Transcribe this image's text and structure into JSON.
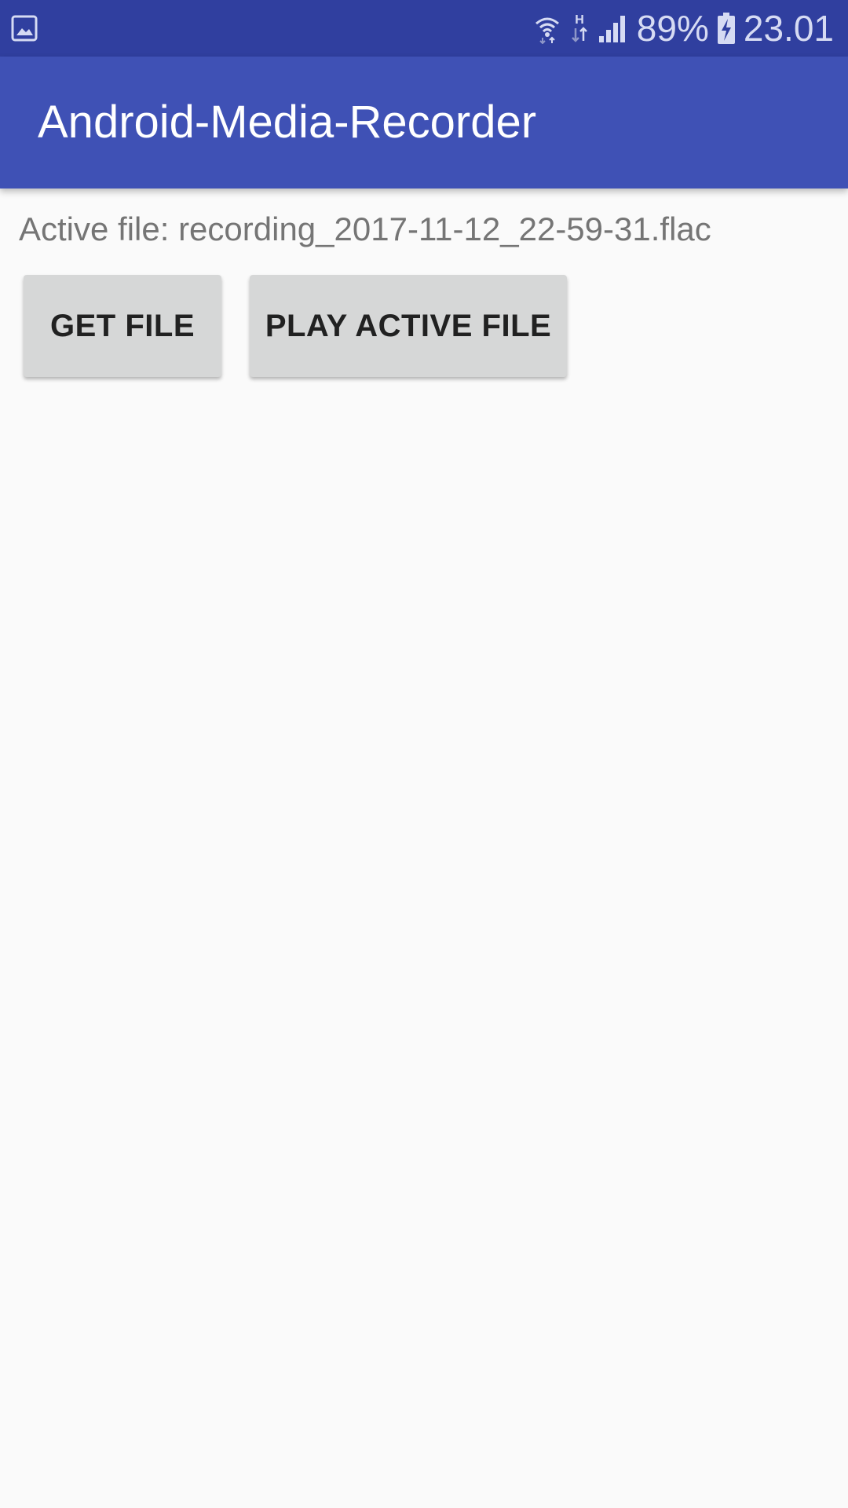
{
  "status_bar": {
    "left_icon": "image-notification-icon",
    "icons": [
      "wifi-icon",
      "hspa-data-icon",
      "signal-icon"
    ],
    "battery_percent": "89%",
    "battery_icon": "battery-charging-icon",
    "time": "23.01"
  },
  "app_bar": {
    "title": "Android-Media-Recorder"
  },
  "main": {
    "active_file_text": "Active file: recording_2017-11-12_22-59-31.flac",
    "buttons": {
      "get_file": "GET FILE",
      "play_active_file": "PLAY ACTIVE FILE"
    }
  },
  "colors": {
    "status_bar": "#303f9f",
    "app_bar": "#3f51b5",
    "background": "#fafafa",
    "button": "#d6d7d7",
    "text_secondary": "#757575"
  }
}
